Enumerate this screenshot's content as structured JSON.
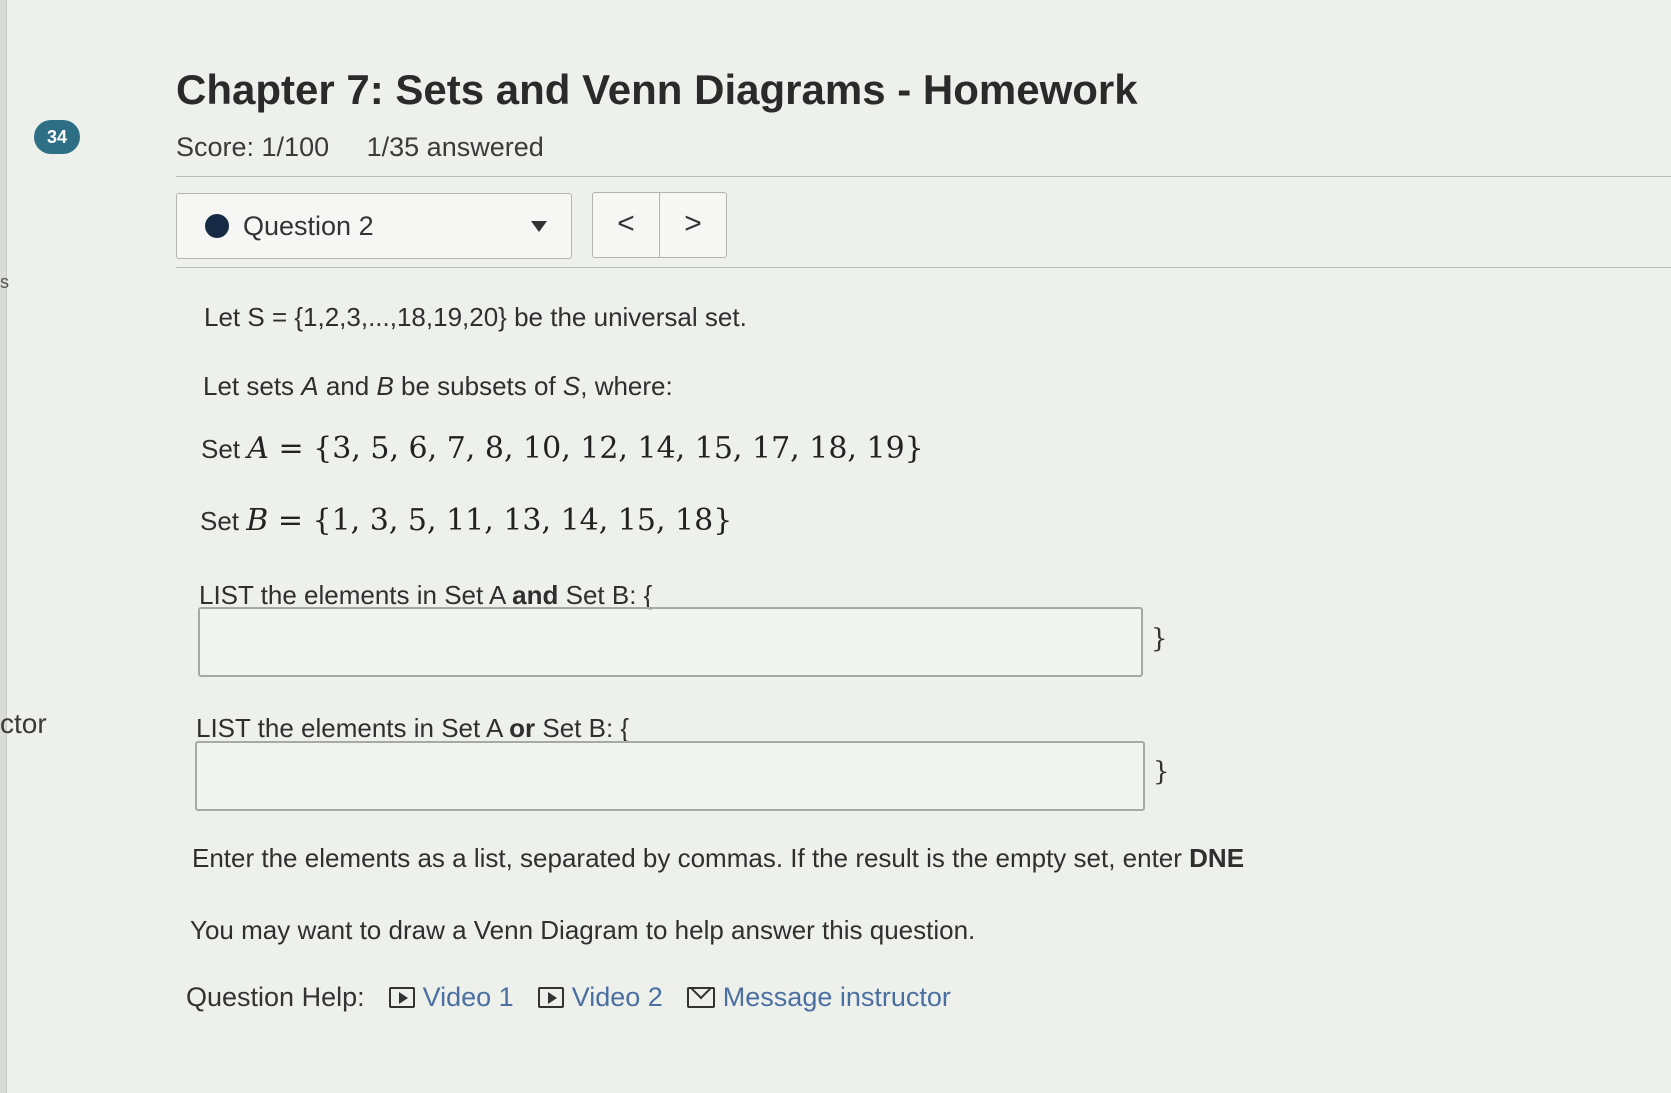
{
  "sidebar": {
    "badge": "34",
    "fragment_text": "ctor",
    "fragment_mark": "s"
  },
  "header": {
    "title": "Chapter 7: Sets and Venn Diagrams - Homework",
    "score": "Score: 1/100",
    "answered": "1/35 answered"
  },
  "nav": {
    "question_selector": "Question 2",
    "prev_icon": "chevron-left-icon",
    "next_icon": "chevron-right-icon",
    "prev_glyph": "<",
    "next_glyph": ">"
  },
  "question": {
    "universal_prefix": "Let ",
    "universal_math": "S = {1,2,3,...,18,19,20}",
    "universal_suffix": " be the universal set.",
    "subsets_text_1": "Let sets ",
    "subsets_a": "A",
    "subsets_text_2": " and ",
    "subsets_b": "B",
    "subsets_text_3": " be subsets of ",
    "subsets_s": "S",
    "subsets_text_4": ", where:",
    "set_a_prefix": "Set ",
    "set_a_var": "A",
    "set_a_value": " = {3, 5, 6, 7, 8, 10, 12, 14, 15, 17, 18, 19}",
    "set_b_prefix": "Set ",
    "set_b_var": "B",
    "set_b_value": " = {1, 3, 5, 11, 13, 14, 15, 18}",
    "and_prompt_1": "LIST the elements in Set A ",
    "and_prompt_bold": "and",
    "and_prompt_2": " Set B: {",
    "and_value": "",
    "or_prompt_1": "LIST the elements in Set A ",
    "or_prompt_bold": "or",
    "or_prompt_2": " Set B: {",
    "or_value": "",
    "close_brace": "}",
    "instructions_1": "Enter the elements as a list, separated by commas. If the result is the empty set, enter ",
    "instructions_bold": "DNE",
    "venn_hint": "You may want to draw a Venn Diagram to help answer this question."
  },
  "help": {
    "label": "Question Help:",
    "video1": "Video 1",
    "video2": "Video 2",
    "message": "Message instructor"
  }
}
